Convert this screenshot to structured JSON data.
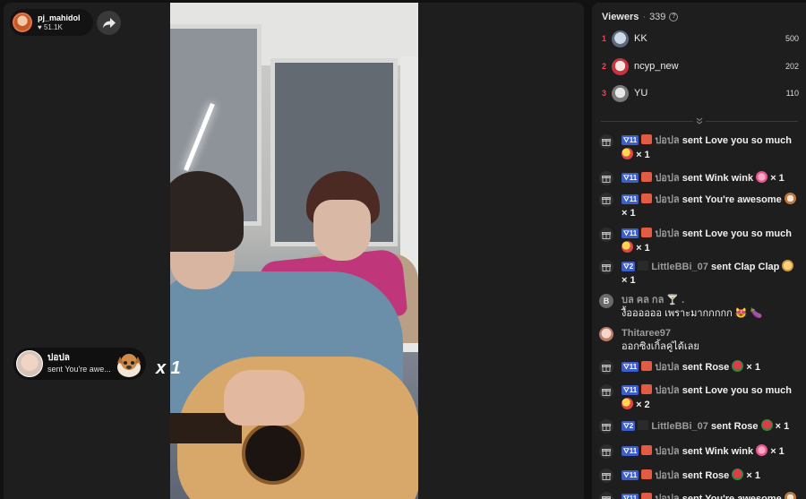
{
  "stream": {
    "host_name": "pj_mahidol",
    "host_likes": "51.1K",
    "gift_toast": {
      "sender": "ปอปล",
      "message": "sent You're awe...",
      "count": "x 1"
    }
  },
  "viewers": {
    "title": "Viewers",
    "separator": "·",
    "count": "339",
    "top": [
      {
        "rank": "1",
        "name": "KK",
        "score": "500"
      },
      {
        "rank": "2",
        "name": "ncyp_new",
        "score": "202"
      },
      {
        "rank": "3",
        "name": "YU",
        "score": "110"
      }
    ]
  },
  "chat": [
    {
      "level": "11",
      "user": "ปอปล",
      "action": "sent Love you so much",
      "count": "× 1",
      "gift": "love-you-so-much"
    },
    {
      "level": "11",
      "user": "ปอปล",
      "action": "sent Wink wink",
      "count": "× 1",
      "gift": "wink-wink"
    },
    {
      "level": "11",
      "user": "ปอปล",
      "action": "sent You're awesome",
      "count": "× 1",
      "gift": "youre-awesome"
    },
    {
      "level": "11",
      "user": "ปอปล",
      "action": "sent Love you so much",
      "count": "× 1",
      "gift": "love-you-so-much"
    },
    {
      "level": "2",
      "user": "LittleBBi_07",
      "action": "sent Clap Clap",
      "count": "× 1",
      "gift": "clap-clap"
    },
    {
      "comment_user": "บล คล กล 🍸 .",
      "comment_text": "งื้ออออออ เพราะมากกกกก 😻 🍆",
      "avatar_letter": "B"
    },
    {
      "comment_user": "Thitaree97",
      "comment_text": "ออกซิงเกิ้ลคู่ได้เลย"
    },
    {
      "level": "11",
      "user": "ปอปล",
      "action": "sent Rose",
      "count": "× 1",
      "gift": "rose"
    },
    {
      "level": "11",
      "user": "ปอปล",
      "action": "sent Love you so much",
      "count": "× 2",
      "gift": "love-you-so-much"
    },
    {
      "level": "2",
      "user": "LittleBBi_07",
      "action": "sent Rose",
      "count": "× 1",
      "gift": "rose"
    },
    {
      "level": "11",
      "user": "ปอปล",
      "action": "sent Wink wink",
      "count": "× 1",
      "gift": "wink-wink"
    },
    {
      "level": "11",
      "user": "ปอปล",
      "action": "sent Rose",
      "count": "× 1",
      "gift": "rose"
    },
    {
      "level": "11",
      "user": "ปอปล",
      "action": "sent You're awesome",
      "count": "",
      "gift": "youre-awesome"
    }
  ],
  "colors": {
    "rank": "#ff3b5c",
    "level_badge": "#3d5ec9",
    "muted_user": "#9a9a9a"
  }
}
